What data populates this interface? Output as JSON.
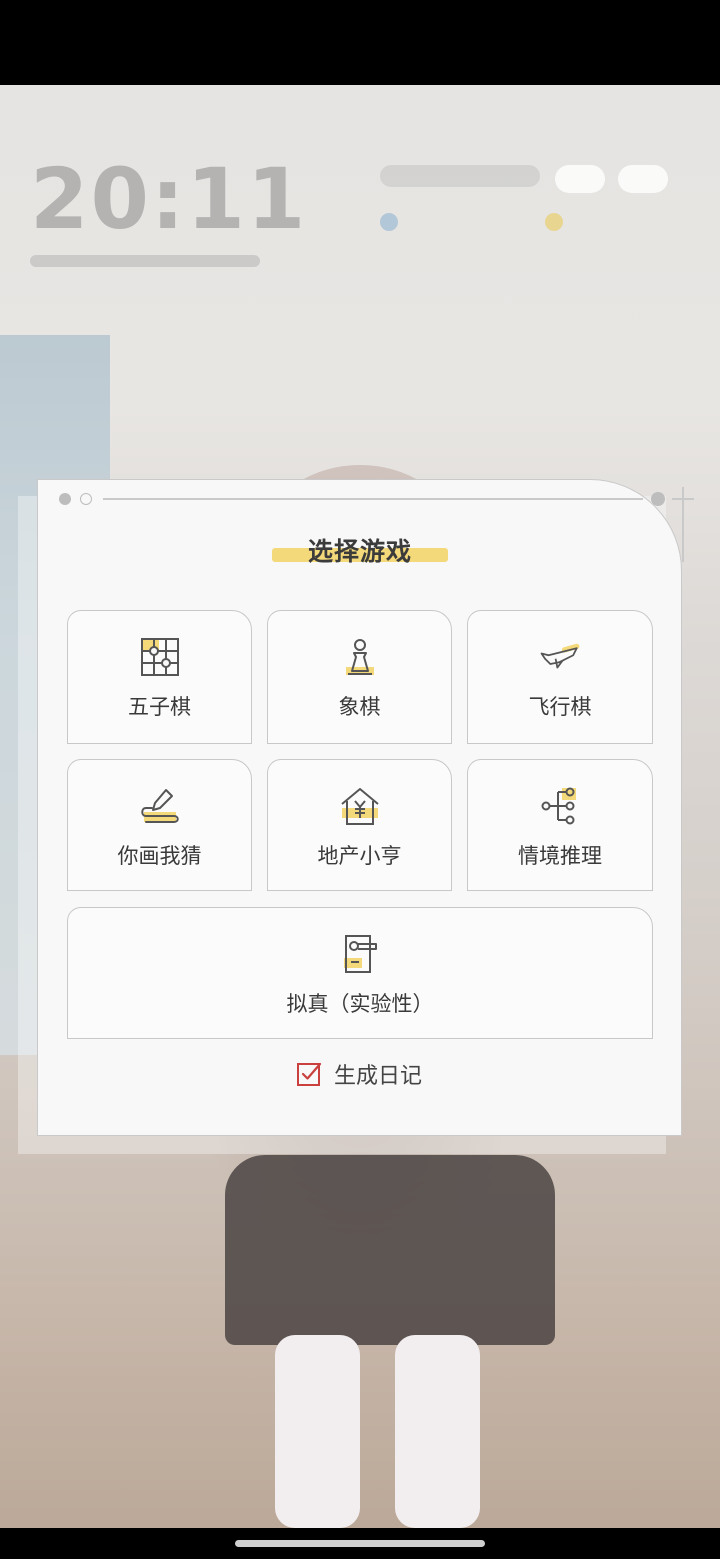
{
  "background": {
    "clock": "20:11"
  },
  "dialog": {
    "title": "选择游戏",
    "games": [
      {
        "label": "五子棋",
        "icon": "gomoku-board-icon"
      },
      {
        "label": "象棋",
        "icon": "chess-pawn-icon"
      },
      {
        "label": "飞行棋",
        "icon": "airplane-icon"
      },
      {
        "label": "你画我猜",
        "icon": "pencil-draw-icon"
      },
      {
        "label": "地产小亨",
        "icon": "house-yuan-icon"
      },
      {
        "label": "情境推理",
        "icon": "branch-tree-icon"
      },
      {
        "label": "拟真（实验性）",
        "icon": "door-handle-icon"
      }
    ],
    "generate_diary": {
      "label": "生成日记",
      "checked": true
    }
  },
  "colors": {
    "accent_yellow": "#f4d97a",
    "checkbox_red": "#c9403e",
    "icon_stroke": "#555555"
  }
}
